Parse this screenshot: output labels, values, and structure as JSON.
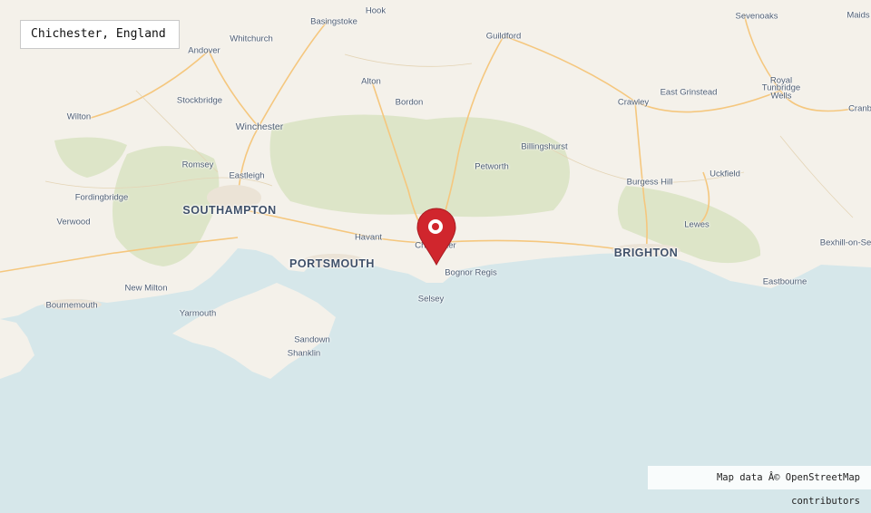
{
  "title": "Chichester, England",
  "attribution": "Map data Â© OpenStreetMap contributors",
  "colors": {
    "sea": "#d6e7ea",
    "land": "#f4f1ea",
    "forest": "#dde5c8",
    "road": "#f5c77e",
    "marker": "#d0262d"
  },
  "marker": {
    "name": "Chichester",
    "icon": "map-pin-icon"
  },
  "places": [
    {
      "name": "Hook",
      "size": "small"
    },
    {
      "name": "Basingstoke",
      "size": "small"
    },
    {
      "name": "Andover",
      "size": "small"
    },
    {
      "name": "Whitchurch",
      "size": "small"
    },
    {
      "name": "Guildford",
      "size": "small"
    },
    {
      "name": "Sevenoaks",
      "size": "small"
    },
    {
      "name": "Maids",
      "size": "small"
    },
    {
      "name": "Alton",
      "size": "small"
    },
    {
      "name": "Bordon",
      "size": "small"
    },
    {
      "name": "East Grinstead",
      "size": "small"
    },
    {
      "name": "Royal",
      "size": "small"
    },
    {
      "name": "Tunbridge",
      "size": "small"
    },
    {
      "name": "Wells",
      "size": "small"
    },
    {
      "name": "Stockbridge",
      "size": "small"
    },
    {
      "name": "Crawley",
      "size": "small"
    },
    {
      "name": "Wilton",
      "size": "small"
    },
    {
      "name": "Cranb",
      "size": "small"
    },
    {
      "name": "Winchester",
      "size": "medium"
    },
    {
      "name": "Billingshurst",
      "size": "small"
    },
    {
      "name": "Romsey",
      "size": "small"
    },
    {
      "name": "Petworth",
      "size": "small"
    },
    {
      "name": "Eastleigh",
      "size": "small"
    },
    {
      "name": "Uckfield",
      "size": "small"
    },
    {
      "name": "Fordingbridge",
      "size": "small"
    },
    {
      "name": "Burgess Hill",
      "size": "small"
    },
    {
      "name": "SOUTHAMPTON",
      "size": "large"
    },
    {
      "name": "Verwood",
      "size": "small"
    },
    {
      "name": "Lewes",
      "size": "small"
    },
    {
      "name": "Havant",
      "size": "small"
    },
    {
      "name": "Chichester",
      "size": "small"
    },
    {
      "name": "Bexhill-on-Se",
      "size": "small"
    },
    {
      "name": "BRIGHTON",
      "size": "large"
    },
    {
      "name": "PORTSMOUTH",
      "size": "large"
    },
    {
      "name": "Bognor Regis",
      "size": "small"
    },
    {
      "name": "New Milton",
      "size": "small"
    },
    {
      "name": "Eastbourne",
      "size": "small"
    },
    {
      "name": "Selsey",
      "size": "small"
    },
    {
      "name": "Bournemouth",
      "size": "small"
    },
    {
      "name": "Yarmouth",
      "size": "small"
    },
    {
      "name": "Sandown",
      "size": "small"
    },
    {
      "name": "Shanklin",
      "size": "small"
    }
  ]
}
